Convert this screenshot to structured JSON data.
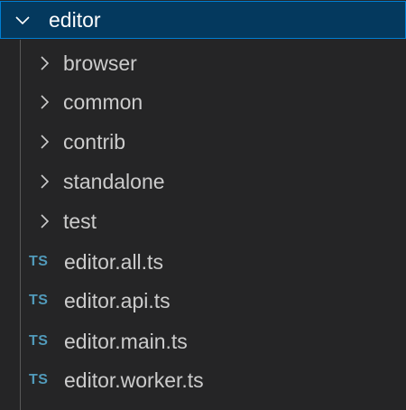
{
  "explorer": {
    "root": {
      "label": "editor",
      "expanded": true,
      "icon": "chevron-down-icon"
    },
    "folders": [
      {
        "label": "browser",
        "icon": "chevron-right-icon"
      },
      {
        "label": "common",
        "icon": "chevron-right-icon"
      },
      {
        "label": "contrib",
        "icon": "chevron-right-icon"
      },
      {
        "label": "standalone",
        "icon": "chevron-right-icon"
      },
      {
        "label": "test",
        "icon": "chevron-right-icon"
      }
    ],
    "files": [
      {
        "label": "editor.all.ts",
        "badge": "TS"
      },
      {
        "label": "editor.api.ts",
        "badge": "TS"
      },
      {
        "label": "editor.main.ts",
        "badge": "TS"
      },
      {
        "label": "editor.worker.ts",
        "badge": "TS"
      }
    ]
  },
  "colors": {
    "background": "#252526",
    "selection": "#04395e",
    "focus_border": "#007fd4",
    "text": "#cccccc",
    "ts_icon": "#519aba"
  }
}
